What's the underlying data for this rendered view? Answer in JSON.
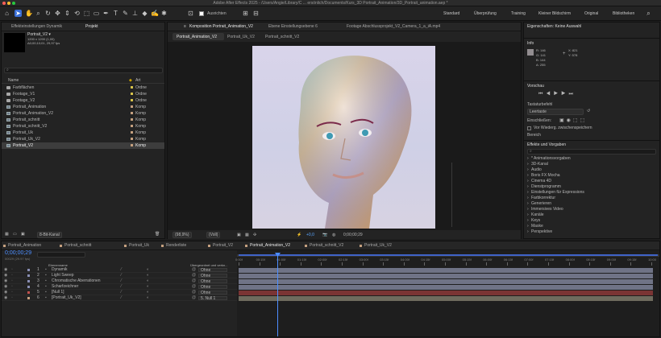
{
  "app": {
    "window_title": "Adobe After Effects 2025 - /Users/Angie/Library/C ... ersönlich/Documents/Kurs_3D Portrait_Animation/3D_Portrait_animation.aep *"
  },
  "toolbar": {
    "snap_label": "Ausrichten",
    "workspaces": [
      "Standard",
      "Überprüfung",
      "Training",
      "Kleiner Bildschirm",
      "Original",
      "Bibliotheken"
    ]
  },
  "project": {
    "tabs": [
      "Effekteinstellungen Dynamik",
      "Projekt"
    ],
    "selected_name": "Portrait_V2 ▾",
    "selected_info": [
      "1200 x 1200 (1,00)",
      "Δ0;00;10;01, 29,97 fps"
    ],
    "columns": {
      "name": "Name",
      "type": "Art"
    },
    "items": [
      {
        "name": "Farbflächen",
        "type": "Ordne",
        "kind": "folder",
        "color": "#d8c34a"
      },
      {
        "name": "Footage_V1",
        "type": "Ordne",
        "kind": "folder",
        "color": "#d8c34a"
      },
      {
        "name": "Footage_V2",
        "type": "Ordne",
        "kind": "folder",
        "color": "#d8c34a"
      },
      {
        "name": "Portrait_Animation",
        "type": "Komp",
        "kind": "comp",
        "color": "#c5a07f"
      },
      {
        "name": "Portrait_Animation_V2",
        "type": "Komp",
        "kind": "comp",
        "color": "#c5a07f"
      },
      {
        "name": "Portrait_schnitt",
        "type": "Komp",
        "kind": "comp",
        "color": "#c5a07f"
      },
      {
        "name": "Portrait_schnitt_V2",
        "type": "Komp",
        "kind": "comp",
        "color": "#c5a07f"
      },
      {
        "name": "Portrait_Uk",
        "type": "Komp",
        "kind": "comp",
        "color": "#c5a07f"
      },
      {
        "name": "Portrait_Uk_V2",
        "type": "Komp",
        "kind": "comp",
        "color": "#c5a07f"
      },
      {
        "name": "Portrait_V2",
        "type": "Komp",
        "kind": "comp",
        "color": "#c5a07f",
        "selected": true
      }
    ],
    "bit_depth": "8-Bit-Kanal"
  },
  "viewer": {
    "top_tabs": [
      "Komposition Portrait_Animation_V2",
      "Ebene Einstellungsebene 6",
      "Footage Abschlussprojekt_V2_Camera_1_a_iA.mp4"
    ],
    "sub_tabs": [
      "Portrait_Animation_V2",
      "Portrait_Uk_V2",
      "Portrait_schnitt_V2"
    ],
    "zoom": "(98,9%)",
    "resolution": "(Voll)",
    "exposure": "+0,0",
    "timecode": "0;00;00;29"
  },
  "info": {
    "title_props": "Eigenschaften: Keine Auswahl",
    "title": "Info",
    "r": "R: 146",
    "g": "G: 141",
    "b": "B: 144",
    "a": "A: 255",
    "x": "X: 821",
    "y": "Y: 578"
  },
  "preview": {
    "title": "Vorschau",
    "shortcut_label": "Tastaturbefehl",
    "shortcut_value": "Leertaste",
    "include_label": "Einschließen:",
    "loop_label": "Vor Wiederg. zwischenspeichern",
    "range_label": "Bereich"
  },
  "effects": {
    "title": "Effekte und Vorgaben",
    "items": [
      "* Animationsvorgaben",
      "3D-Kanal",
      "Audio",
      "Boris FX Mocha",
      "Cinema 4D",
      "Dienstprogramm",
      "Einstellungen für Expressions",
      "Farbkorrektur",
      "Generieren",
      "Immersives Video",
      "Kanäle",
      "Keys",
      "Maske",
      "Perspektive"
    ]
  },
  "timeline": {
    "tabs": [
      "Portrait_Animation",
      "Portrait_schnitt",
      "Portrait_Uk",
      "Renderliste",
      "Portrait_V2",
      "Portrait_Animation_V2",
      "Portrait_schnitt_V2",
      "Portrait_Uk_V2"
    ],
    "timecode": "0;00;00;29",
    "fps": "00029 (29.97 fps)",
    "col_name": "Ebenenname",
    "col_parent": "Übergeordnet und verkn...",
    "ruler": [
      "0:00f",
      "00:15f",
      "01:00f",
      "01:15f",
      "02:00f",
      "02:15f",
      "03:00f",
      "03:15f",
      "04:00f",
      "04:15f",
      "05:00f",
      "05:15f",
      "06:00f",
      "06:15f",
      "07:00f",
      "07:15f",
      "08:00f",
      "08:15f",
      "09:00f",
      "09:15f",
      "10:00"
    ],
    "layers": [
      {
        "num": "1",
        "name": "Dynamik",
        "parent": "Ohne",
        "color": "#8a8fb5",
        "bar": "#6f7386"
      },
      {
        "num": "2",
        "name": "Light Sweep",
        "parent": "Ohne",
        "color": "#8a8fb5",
        "bar": "#6f7386"
      },
      {
        "num": "3",
        "name": "Chromatische Aberrationen",
        "parent": "Ohne",
        "color": "#8a8fb5",
        "bar": "#6f7386"
      },
      {
        "num": "4",
        "name": "Scharfzeichner",
        "parent": "Ohne",
        "color": "#8a8fb5",
        "bar": "#6f7386"
      },
      {
        "num": "5",
        "name": "[Null 1]",
        "parent": "Ohne",
        "color": "#c0504d",
        "bar": "#7a3434"
      },
      {
        "num": "6",
        "name": "[Portrait_Uk_V2]",
        "parent": "5. Null 1",
        "color": "#c5a07f",
        "bar": "#6e6b5e"
      }
    ]
  }
}
